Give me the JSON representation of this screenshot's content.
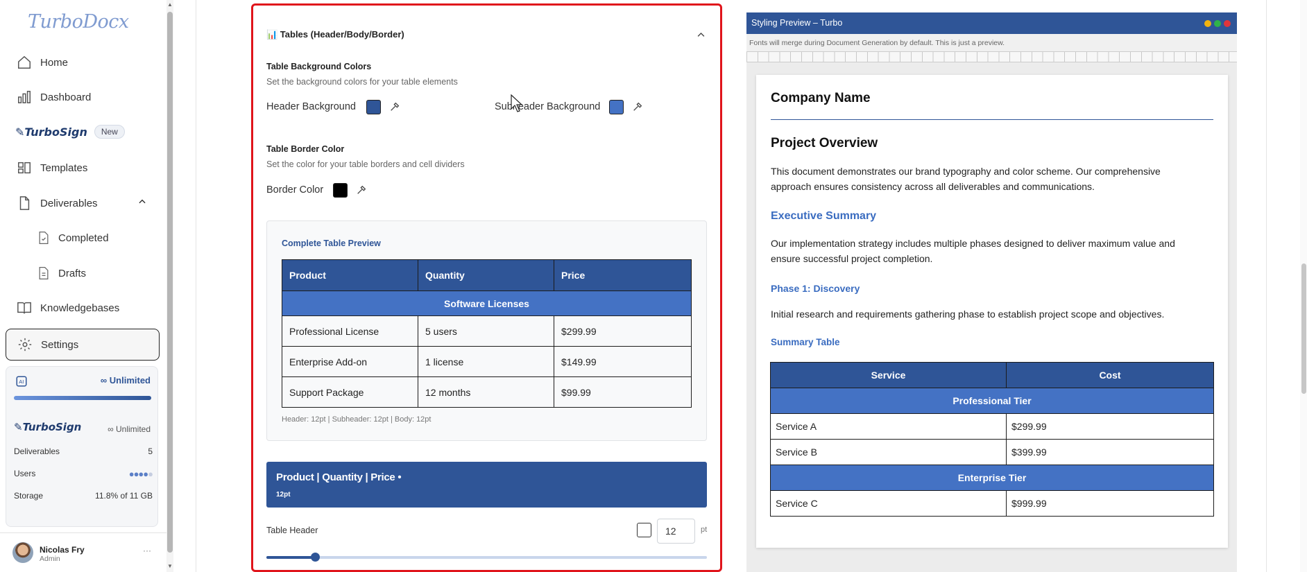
{
  "sidebar": {
    "logo": "TurboDocx",
    "items": {
      "home": "Home",
      "dashboard": "Dashboard",
      "turbosign": "TurboSign",
      "new_badge": "New",
      "templates": "Templates",
      "deliverables": "Deliverables",
      "completed": "Completed",
      "drafts": "Drafts",
      "knowledgebases": "Knowledgebases",
      "settings": "Settings"
    },
    "plan": {
      "unlimited": "Unlimited",
      "turbosign": "TurboSign",
      "turbosign_unlimited": "Unlimited",
      "progress": 1.0,
      "rows": [
        {
          "label": "Deliverables",
          "value": "5"
        },
        {
          "label": "Users",
          "value": ""
        },
        {
          "label": "Storage",
          "value": "11.8% of 11 GB"
        }
      ]
    },
    "user": {
      "name": "Nicolas Fry",
      "role": "Admin"
    }
  },
  "panel": {
    "title": "📊 Tables (Header/Body/Border)",
    "bg_title": "Table Background Colors",
    "bg_sub": "Set the background colors for your table elements",
    "header_bg": "Header Background",
    "subheader_bg": "Subheader Background",
    "border_title": "Table Border Color",
    "border_sub": "Set the color for your table borders and cell dividers",
    "border_color": "Border Color",
    "colors": {
      "header": "#2f5597",
      "subheader": "#4472c4",
      "border": "#000000"
    },
    "complete_preview": "Complete Table Preview",
    "table": {
      "headers": [
        "Product",
        "Quantity",
        "Price"
      ],
      "subheader": "Software Licenses",
      "rows": [
        [
          "Professional License",
          "5 users",
          "$299.99"
        ],
        [
          "Enterprise Add-on",
          "1 license",
          "$149.99"
        ],
        [
          "Support Package",
          "12 months",
          "$99.99"
        ]
      ]
    },
    "sizes_note": "Header: 12pt | Subheader: 12pt | Body: 12pt",
    "banner_title": "Product | Quantity | Price •",
    "banner_sub": "12pt",
    "table_header_label": "Table Header",
    "table_header_size": "12",
    "unit": "pt",
    "slider_value": 0.11
  },
  "preview": {
    "window_title": "Styling Preview – Turbo",
    "note": "Fonts will merge during Document Generation by default. This is just a preview.",
    "company": "Company Name",
    "project": "Project Overview",
    "p1": "This document demonstrates our brand typography and color scheme. Our comprehensive approach ensures consistency across all deliverables and communications.",
    "exec": "Executive Summary",
    "p2": "Our implementation strategy includes multiple phases designed to deliver maximum value and ensure successful project completion.",
    "phase": "Phase 1: Discovery",
    "p3": "Initial research and requirements gathering phase to establish project scope and objectives.",
    "summary": "Summary Table",
    "table": {
      "headers": [
        "Service",
        "Cost"
      ],
      "groups": [
        {
          "name": "Professional Tier",
          "rows": [
            [
              "Service A",
              "$299.99"
            ],
            [
              "Service B",
              "$399.99"
            ]
          ]
        },
        {
          "name": "Enterprise Tier",
          "rows": [
            [
              "Service C",
              "$999.99"
            ]
          ]
        }
      ]
    }
  }
}
